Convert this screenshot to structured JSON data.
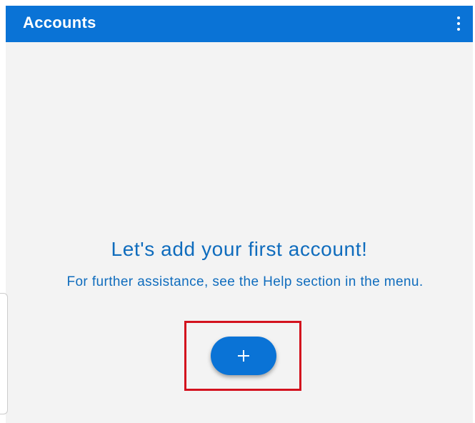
{
  "app_bar": {
    "title": "Accounts",
    "overflow_icon": "more-vertical-icon",
    "background": "#0a73d6"
  },
  "empty_state": {
    "headline": "Let's add your first account!",
    "help_text": "For further assistance, see the Help section in the menu."
  },
  "fab": {
    "icon": "plus-icon",
    "color": "#0a73d6"
  },
  "annotation": {
    "highlight_color": "#d3121e"
  }
}
